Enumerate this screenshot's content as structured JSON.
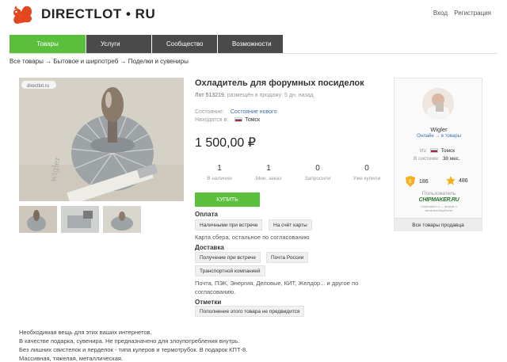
{
  "site": {
    "logo_text": "DIRECTLOT • RU",
    "login_label": "Вход",
    "register_label": "Регистрация"
  },
  "nav": {
    "items": [
      {
        "label": "Товары"
      },
      {
        "label": "Услуги"
      },
      {
        "label": "Сообщество"
      },
      {
        "label": "Возможности"
      }
    ]
  },
  "breadcrumb": {
    "text": "Все товары → Бытовое и ширпотреб → Поделки и сувениры"
  },
  "gallery": {
    "watermark": "directlot.ru"
  },
  "product": {
    "title": "Охладитель для форумных посиделок",
    "lot_label": "Лот 513219",
    "lot_meta": ", размещён в продажу: 5 дн. назад",
    "condition_label": "Состояние:",
    "condition_value": "Состояние нового",
    "location_label": "Находится в:",
    "location_value": "Томск",
    "price": "1 500,00 ₽",
    "stats": [
      {
        "value": "1",
        "label": "В наличии"
      },
      {
        "value": "1",
        "label": "Мин. заказ"
      },
      {
        "value": "0",
        "label": "Запросили"
      },
      {
        "value": "0",
        "label": "Уже купили"
      }
    ],
    "buy_label": "КУПИТЬ"
  },
  "payment": {
    "title": "Оплата",
    "options": [
      "Наличными при встрече",
      "На счёт карты"
    ],
    "note": "Карта сбера, остальное по согласованию"
  },
  "delivery": {
    "title": "Доставка",
    "options": [
      "Получение при встрече",
      "Почта России",
      "Транспортной компанией"
    ],
    "note": "Почта, ПЭК, Энергия, Деловые, КИТ, Желдор... и другое по согласованию."
  },
  "marks": {
    "title": "Отметки",
    "options": [
      "Пополнение этого товара не предвидится"
    ]
  },
  "seller": {
    "name": "Wigler",
    "status": "Онлайн → в товары",
    "from_label": "Из:",
    "from_value": "Томск",
    "since_label": "В системе:",
    "since_value": "38 мес.",
    "rating_shield": "186",
    "rating_star": "486",
    "user_label": "Пользователь",
    "badge": "CHIPMAKER.RU",
    "badge_sub": "Chipmaker.ru — форум о металлообработке",
    "all_items_label": "Все товары продавца"
  },
  "description": {
    "lines": [
      "Необходимая вещь для этих ваших интернетов.",
      "В качестве подарка, сувенира. Не предназначено для злоупотребления внутрь.",
      "Без лишних свистелок и перделок - типа кулеров и термотрубок. В подарок КПТ-8.",
      "Массивная, тяжелая, металлическая."
    ]
  },
  "colors": {
    "accent": "#5bbf3e",
    "nav": "#4a4a4a",
    "link": "#3a6fb0"
  }
}
